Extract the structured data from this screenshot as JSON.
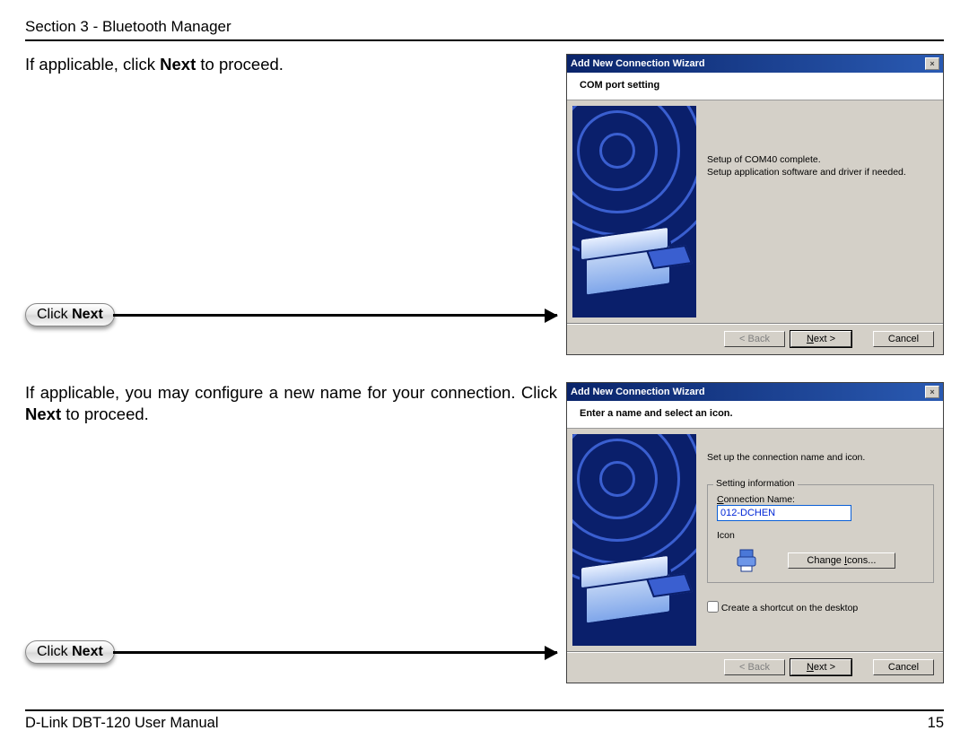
{
  "header": "Section 3 - Bluetooth Manager",
  "block1": {
    "instruction_pre": "If applicable, click ",
    "instruction_bold": "Next",
    "instruction_post": " to proceed.",
    "pill_pre": "Click ",
    "pill_bold": "Next",
    "wizard": {
      "title": "Add New Connection Wizard",
      "subtitle": "COM port setting",
      "msg1": "Setup of COM40 complete.",
      "msg2": "Setup application software and driver if needed.",
      "back": "< Back",
      "next_u": "N",
      "next_rest": "ext >",
      "cancel": "Cancel"
    }
  },
  "block2": {
    "instruction_pre": "If applicable, you may configure a new name for your connection. Click ",
    "instruction_bold": "Next",
    "instruction_post": " to proceed.",
    "pill_pre": "Click ",
    "pill_bold": "Next",
    "wizard": {
      "title": "Add New Connection Wizard",
      "subtitle": "Enter a name and select an icon.",
      "heading": "Set up the connection name and icon.",
      "fieldset": "Setting information",
      "conn_label_u": "C",
      "conn_label_rest": "onnection Name:",
      "conn_value": "012-DCHEN",
      "icon_label": "Icon",
      "change_u": "I",
      "change_rest": "cons...",
      "change_pre": "Change ",
      "shortcut": "Create a shortcut on the desktop",
      "back": "< Back",
      "next_u": "N",
      "next_rest": "ext >",
      "cancel": "Cancel"
    }
  },
  "footer": {
    "left": "D-Link DBT-120 User Manual",
    "right": "15"
  }
}
